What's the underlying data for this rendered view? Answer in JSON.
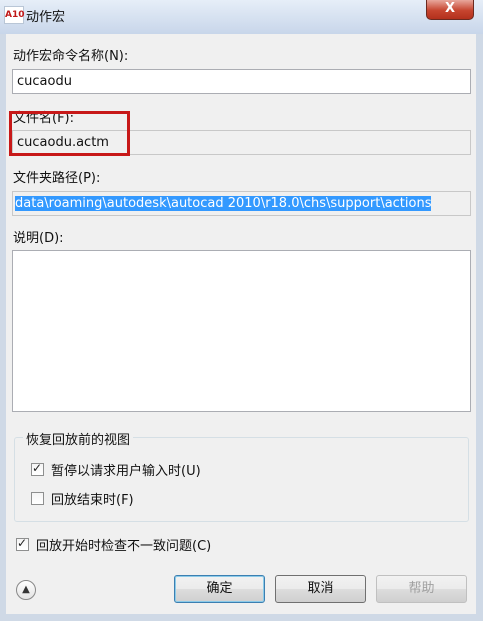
{
  "window": {
    "title": "动作宏",
    "app_icon_text": "A10",
    "close_glyph": "X"
  },
  "fields": {
    "command_name": {
      "label": "动作宏命令名称(N):",
      "value": "cucaodu"
    },
    "file_name": {
      "label": "文件名(F):",
      "value": "cucaodu.actm"
    },
    "folder_path": {
      "label": "文件夹路径(P):",
      "value": "data\\roaming\\autodesk\\autocad 2010\\r18.0\\chs\\support\\actions"
    },
    "description": {
      "label": "说明(D):",
      "value": ""
    }
  },
  "restore_view": {
    "title": "恢复回放前的视图",
    "options": [
      {
        "label": "暂停以请求用户输入时(U)",
        "checked": true
      },
      {
        "label": "回放结束时(F)",
        "checked": false
      }
    ]
  },
  "check_inconsistency": {
    "label": "回放开始时检查不一致问题(C)",
    "checked": true
  },
  "buttons": {
    "ok": "确定",
    "cancel": "取消",
    "help": "帮助",
    "expand_glyph": "▲"
  },
  "colors": {
    "highlight_box": "#c71818",
    "selection": "#3399ff"
  }
}
